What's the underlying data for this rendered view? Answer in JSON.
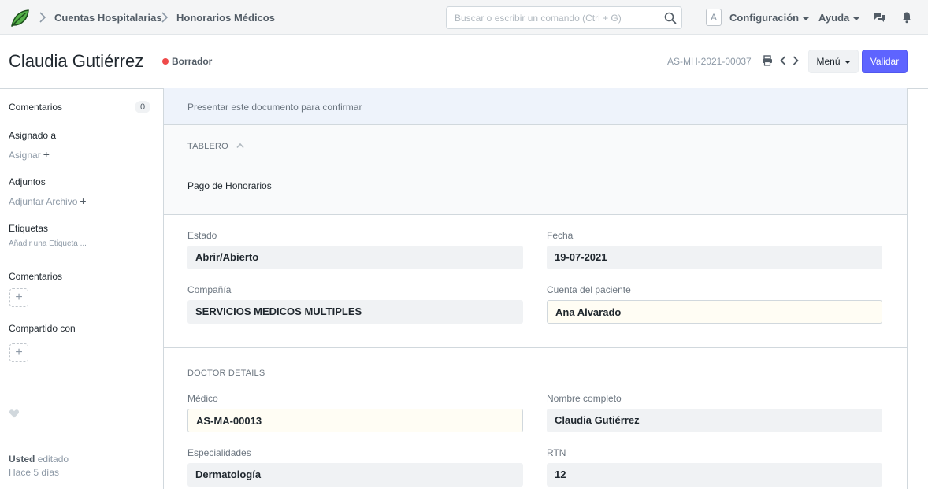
{
  "navbar": {
    "breadcrumbs": [
      "Cuentas Hospitalarias",
      "Honorarios Médicos"
    ],
    "search_placeholder": "Buscar o escribir un comando (Ctrl + G)",
    "avatar_letter": "A",
    "settings_label": "Configuración",
    "help_label": "Ayuda"
  },
  "header": {
    "title": "Claudia Gutiérrez",
    "status": "Borrador",
    "doc_id": "AS-MH-2021-00037",
    "menu_label": "Menú",
    "validate_label": "Validar"
  },
  "sidebar": {
    "comments_label": "Comentarios",
    "comments_count": "0",
    "assigned_label": "Asignado a",
    "assign_action": "Asignar",
    "attachments_label": "Adjuntos",
    "attach_action": "Adjuntar Archivo",
    "tags_label": "Etiquetas",
    "add_tag_action": "Añadir una Etiqueta ...",
    "comments2_label": "Comentarios",
    "shared_label": "Compartido con",
    "edited_user": "Usted",
    "edited_text": "editado",
    "edited_time": "Hace 5 días"
  },
  "form": {
    "alert": "Presentar este documento para confirmar",
    "dashboard_title": "TABLERO",
    "dashboard_link": "Pago de Honorarios",
    "fields": {
      "estado": {
        "label": "Estado",
        "value": "Abrir/Abierto"
      },
      "fecha": {
        "label": "Fecha",
        "value": "19-07-2021"
      },
      "compania": {
        "label": "Compañía",
        "value": "SERVICIOS MEDICOS MULTIPLES"
      },
      "cuenta": {
        "label": "Cuenta del paciente",
        "value": "Ana Alvarado"
      }
    },
    "doctor_section_title": "DOCTOR DETAILS",
    "doctor_fields": {
      "medico": {
        "label": "Médico",
        "value": "AS-MA-00013"
      },
      "nombre": {
        "label": "Nombre completo",
        "value": "Claudia Gutiérrez"
      },
      "especialidades": {
        "label": "Especialidades",
        "value": "Dermatología"
      },
      "rtn": {
        "label": "RTN",
        "value": "12"
      }
    }
  },
  "colors": {
    "primary": "#5e64ff",
    "status_draft": "#ef4a4a",
    "logo_green": "#4caf50"
  }
}
